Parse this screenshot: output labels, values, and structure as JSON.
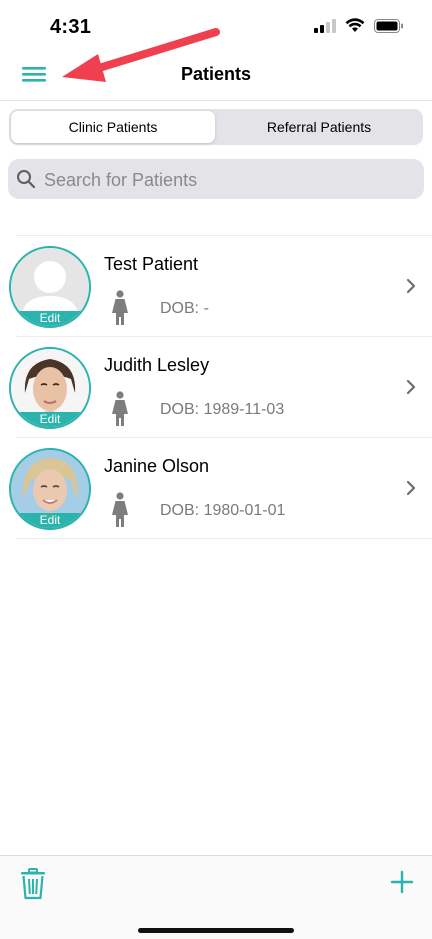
{
  "status_bar": {
    "time": "4:31"
  },
  "nav": {
    "title": "Patients",
    "menu_icon": "hamburger-menu-icon"
  },
  "segments": [
    {
      "label": "Clinic Patients",
      "selected": true
    },
    {
      "label": "Referral Patients",
      "selected": false
    }
  ],
  "search": {
    "placeholder": "Search for Patients",
    "value": ""
  },
  "patients": [
    {
      "name": "Test Patient",
      "dob": "DOB: -",
      "avatar_edit": "Edit"
    },
    {
      "name": "Judith Lesley",
      "dob": "DOB: 1989-11-03",
      "avatar_edit": "Edit"
    },
    {
      "name": "Janine Olson",
      "dob": "DOB: 1980-01-01",
      "avatar_edit": "Edit"
    }
  ],
  "colors": {
    "accent": "#2bb3ad",
    "annotation_arrow": "#f0404f"
  }
}
